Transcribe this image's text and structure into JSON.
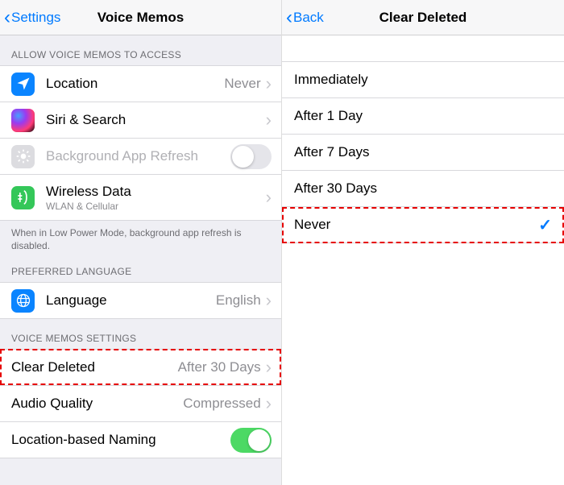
{
  "left": {
    "nav_back": "Settings",
    "nav_title": "Voice Memos",
    "sec_access": "ALLOW VOICE MEMOS TO ACCESS",
    "location": {
      "label": "Location",
      "value": "Never"
    },
    "siri": {
      "label": "Siri & Search"
    },
    "bgrefresh": {
      "label": "Background App Refresh"
    },
    "wireless": {
      "label": "Wireless Data",
      "sub": "WLAN & Cellular"
    },
    "lowpower_note": "When in Low Power Mode, background app refresh is disabled.",
    "sec_lang": "PREFERRED LANGUAGE",
    "language": {
      "label": "Language",
      "value": "English"
    },
    "sec_vm": "VOICE MEMOS SETTINGS",
    "clear": {
      "label": "Clear Deleted",
      "value": "After 30 Days"
    },
    "audio": {
      "label": "Audio Quality",
      "value": "Compressed"
    },
    "locnaming": {
      "label": "Location-based Naming"
    }
  },
  "right": {
    "nav_back": "Back",
    "nav_title": "Clear Deleted",
    "options": {
      "o0": "Immediately",
      "o1": "After 1 Day",
      "o2": "After 7 Days",
      "o3": "After 30 Days",
      "o4": "Never"
    }
  }
}
